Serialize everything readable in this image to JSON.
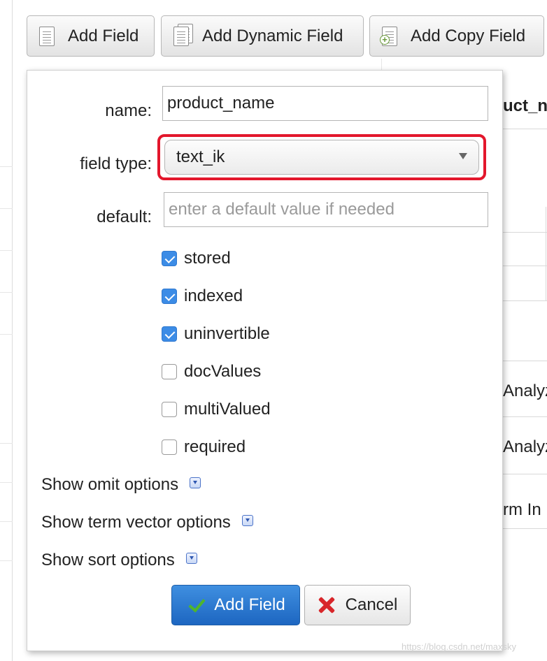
{
  "toolbar": {
    "add_field": "Add Field",
    "add_dynamic_field": "Add Dynamic Field",
    "add_copy_field": "Add Copy Field"
  },
  "background": {
    "field_name_fragment": "uct_na",
    "analyzer_1": "Analyz",
    "analyzer_2": "Analyz",
    "term_fragment": "rm In"
  },
  "dialog": {
    "name_label": "name:",
    "name_value": "product_name",
    "field_type_label": "field type:",
    "field_type_value": "text_ik",
    "default_label": "default:",
    "default_placeholder": "enter a default value if needed",
    "checkboxes": [
      {
        "label": "stored",
        "checked": true
      },
      {
        "label": "indexed",
        "checked": true
      },
      {
        "label": "uninvertible",
        "checked": true
      },
      {
        "label": "docValues",
        "checked": false
      },
      {
        "label": "multiValued",
        "checked": false
      },
      {
        "label": "required",
        "checked": false
      }
    ],
    "show_omit": "Show omit options",
    "show_term_vector": "Show term vector options",
    "show_sort": "Show sort options",
    "submit_label": "Add Field",
    "cancel_label": "Cancel"
  },
  "watermark": "https://blog.csdn.net/maxsky",
  "colors": {
    "highlight_border": "#e3172c",
    "primary_button": "#1d66c1",
    "checkbox_on": "#3c8ce6"
  }
}
